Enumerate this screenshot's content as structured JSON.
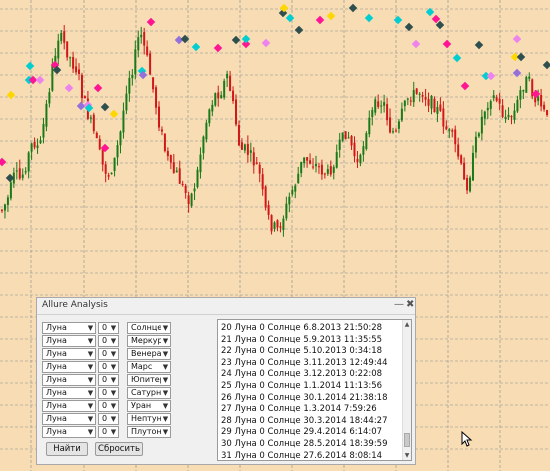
{
  "panel": {
    "title": "Allure Analysis",
    "minimize_label": "—",
    "close_label": "✖",
    "rows": [
      {
        "planet1": "Луна",
        "aspect": "0",
        "planet2": "Солнце"
      },
      {
        "planet1": "Луна",
        "aspect": "0",
        "planet2": "Меркурий"
      },
      {
        "planet1": "Луна",
        "aspect": "0",
        "planet2": "Венера"
      },
      {
        "planet1": "Луна",
        "aspect": "0",
        "planet2": "Марс"
      },
      {
        "planet1": "Луна",
        "aspect": "0",
        "planet2": "Юпитер"
      },
      {
        "planet1": "Луна",
        "aspect": "0",
        "planet2": "Сатурн"
      },
      {
        "planet1": "Луна",
        "aspect": "0",
        "planet2": "Уран"
      },
      {
        "planet1": "Луна",
        "aspect": "0",
        "planet2": "Нептун"
      },
      {
        "planet1": "Луна",
        "aspect": "0",
        "planet2": "Плутон"
      }
    ],
    "find_label": "Найти",
    "reset_label": "Сбросить",
    "results": [
      "20 Луна 0 Солнце 6.8.2013 21:50:28",
      "21 Луна 0 Солнце 5.9.2013 11:35:55",
      "22 Луна 0 Солнце 5.10.2013 0:34:18",
      "23 Луна 0 Солнце 3.11.2013 12:49:44",
      "24 Луна 0 Солнце 3.12.2013 0:22:08",
      "25 Луна 0 Солнце 1.1.2014 11:13:56",
      "26 Луна 0 Солнце 30.1.2014 21:38:18",
      "27 Луна 0 Солнце 1.3.2014 7:59:26",
      "28 Луна 0 Солнце 30.3.2014 18:44:27",
      "29 Луна 0 Солнце 29.4.2014 6:14:07",
      "30 Луна 0 Солнце 28.5.2014 18:39:59",
      "31 Луна 0 Солнце 27.6.2014 8:08:14"
    ]
  },
  "chart": {
    "background": "#f7dcb4",
    "grid_color": "#8c8c8c",
    "bull_color": "#1a7a1a",
    "bear_color": "#d01818",
    "marker_colors": [
      "#ff1493",
      "#00ced1",
      "#2f4f4f",
      "#ee82ee",
      "#ffd700",
      "#9370db"
    ],
    "price_path": [
      60,
      72,
      95,
      90,
      110,
      130,
      120,
      160,
      200,
      235,
      225,
      210,
      200,
      170,
      150,
      130,
      105,
      95,
      110,
      140,
      190,
      205,
      240,
      215,
      185,
      150,
      120,
      100,
      95,
      80,
      70,
      90,
      130,
      160,
      175,
      180,
      195,
      160,
      120,
      120,
      110,
      100,
      60,
      45,
      40,
      55,
      75,
      90,
      110,
      110,
      105,
      100,
      95,
      110,
      125,
      140,
      120,
      100,
      140,
      155,
      170,
      165,
      140,
      135,
      160,
      175,
      175,
      180,
      170,
      165,
      155,
      140,
      130,
      110,
      80,
      105,
      140,
      160,
      175,
      170,
      155,
      150,
      160,
      185,
      190,
      170,
      165,
      150
    ]
  }
}
